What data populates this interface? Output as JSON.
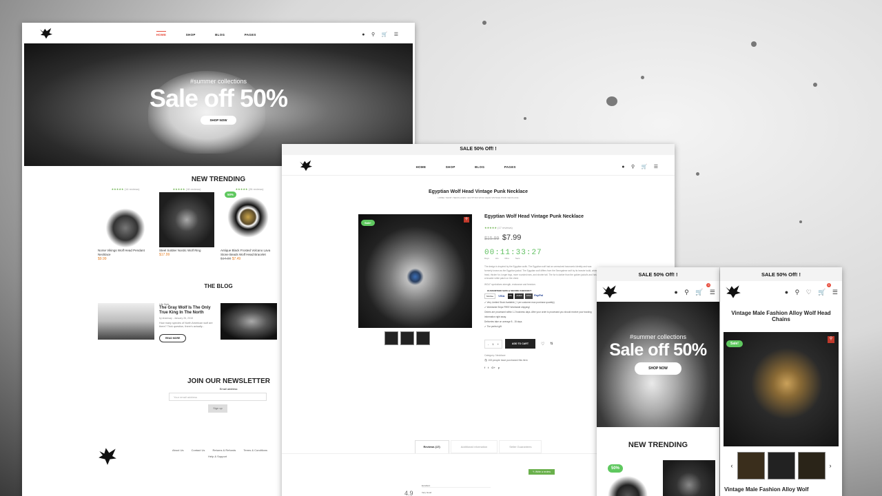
{
  "desktop": {
    "nav": [
      "HOME",
      "SHOP",
      "BLOG",
      "PAGES"
    ],
    "hero": {
      "tagline": "#summer collections",
      "headline": "Sale off 50%",
      "button": "SHOP NOW"
    },
    "trending": {
      "title": "NEW TRENDING",
      "products": [
        {
          "reviews": "(14 reviews)",
          "name": "Norse Vikings Wolf Head Pendant Necklace",
          "price": "$9.99",
          "old": ""
        },
        {
          "reviews": "(18 reviews)",
          "name": "Steel Soldier Nordic Wolf Ring",
          "price": "$17.99",
          "old": ""
        },
        {
          "reviews": "(26 reviews)",
          "name": "Antique Black Frosted Volcano Lava Stone Beads Wolf Head Bracelet",
          "price": "$7.49",
          "old": "$14.99",
          "badge": "50%"
        }
      ]
    },
    "blog": {
      "title": "THE BLOG",
      "category": "Life Style",
      "post_title": "The Gray Wolf Is The Only True King In The North",
      "meta": "by shamsay - January 26, 2018",
      "excerpt": "How many species of North American wolf are there? Trick question, there's actually...",
      "button": "READ MORE"
    },
    "newsletter": {
      "title": "JOIN OUR NEWSLETTER",
      "label": "Email address:",
      "placeholder": "Your email address",
      "button": "Sign up"
    },
    "footer_links": [
      "About Us",
      "Contact Us",
      "Returns & Refunds",
      "Terms & Conditions",
      "Help & Support"
    ]
  },
  "product": {
    "promo": "SALE 50% Off! !",
    "nav": [
      "HOME",
      "SHOP",
      "BLOG",
      "PAGES"
    ],
    "page_title": "Egyptian Wolf Head Vintage Punk Necklace",
    "breadcrumb": "HOME / SHOP / NECKLACES / EGYPTIAN WOLF HEAD VINTAGE PUNK NECKLACE",
    "badge": "Sale!",
    "title": "Egyptian Wolf Head Vintage Punk Necklace",
    "reviews": "(17 reviews)",
    "old_price": "$15.99",
    "price": "$7.99",
    "countdown": {
      "days": "00",
      "hrs": "11",
      "mins": "33",
      "secs": "27",
      "labels": [
        "Days",
        "Hrs",
        "Mins",
        "Secs"
      ]
    },
    "description": "The design is inspired by the Egyptian wolfs. The Egyptian wolf had an unresolved taxonomic identity and was formerly known as the Egyptian jackal. The Egyptian wolf differs from the Senegalese wolf by its heavier build, wider head, thicker fur, longer legs, more rounded ears, and shorter tail. The fur is darker than the golden jackal's and has a broader white patch on the chest.",
    "symbolism": "WOLF symbolizes strength, endurance and freedom.",
    "checkout_title": "GUARANTEED SAFE & SECURE CHECKOUT",
    "payments": [
      "McAfee",
      "VISA",
      "MC",
      "AMEX",
      "DISC",
      "PayPal"
    ],
    "notes": [
      "✔ Very Limited Stock Available ( 1 per customer max purchase quantity)",
      "✔ Worldwide Ships FREE Worldwide shipping!",
      "Orders are processed within 1-2 business days. After your order is processed you should receive your tracking information right away.",
      "Deliveries take on average 8 - 15 days.",
      "✔ The perfect gift"
    ],
    "qty": "1",
    "add_to_cart": "ADD TO CART",
    "category": "Category: Necklace",
    "purchased": "153 people have purchased this item",
    "tabs": [
      "Reviews (17)",
      "Additional information",
      "Seller Guarantees"
    ],
    "write_review": "Write a review",
    "rating_avg": "4.9",
    "rating_rows": [
      "Excellent",
      "Very Good"
    ]
  },
  "mobile_home": {
    "promo": "SALE 50% Off! !",
    "cart_count": "0",
    "hero": {
      "tagline": "#summer collections",
      "headline": "Sale off 50%",
      "button": "SHOP NOW"
    },
    "trending_title": "NEW TRENDING",
    "badge": "50%"
  },
  "mobile_product": {
    "promo": "SALE 50% Off! !",
    "cart_count": "0",
    "title": "Vintage Male Fashion Alloy Wolf Head Chains",
    "badge": "Sale!",
    "next_title": "Vintage Male Fashion Alloy Wolf"
  }
}
